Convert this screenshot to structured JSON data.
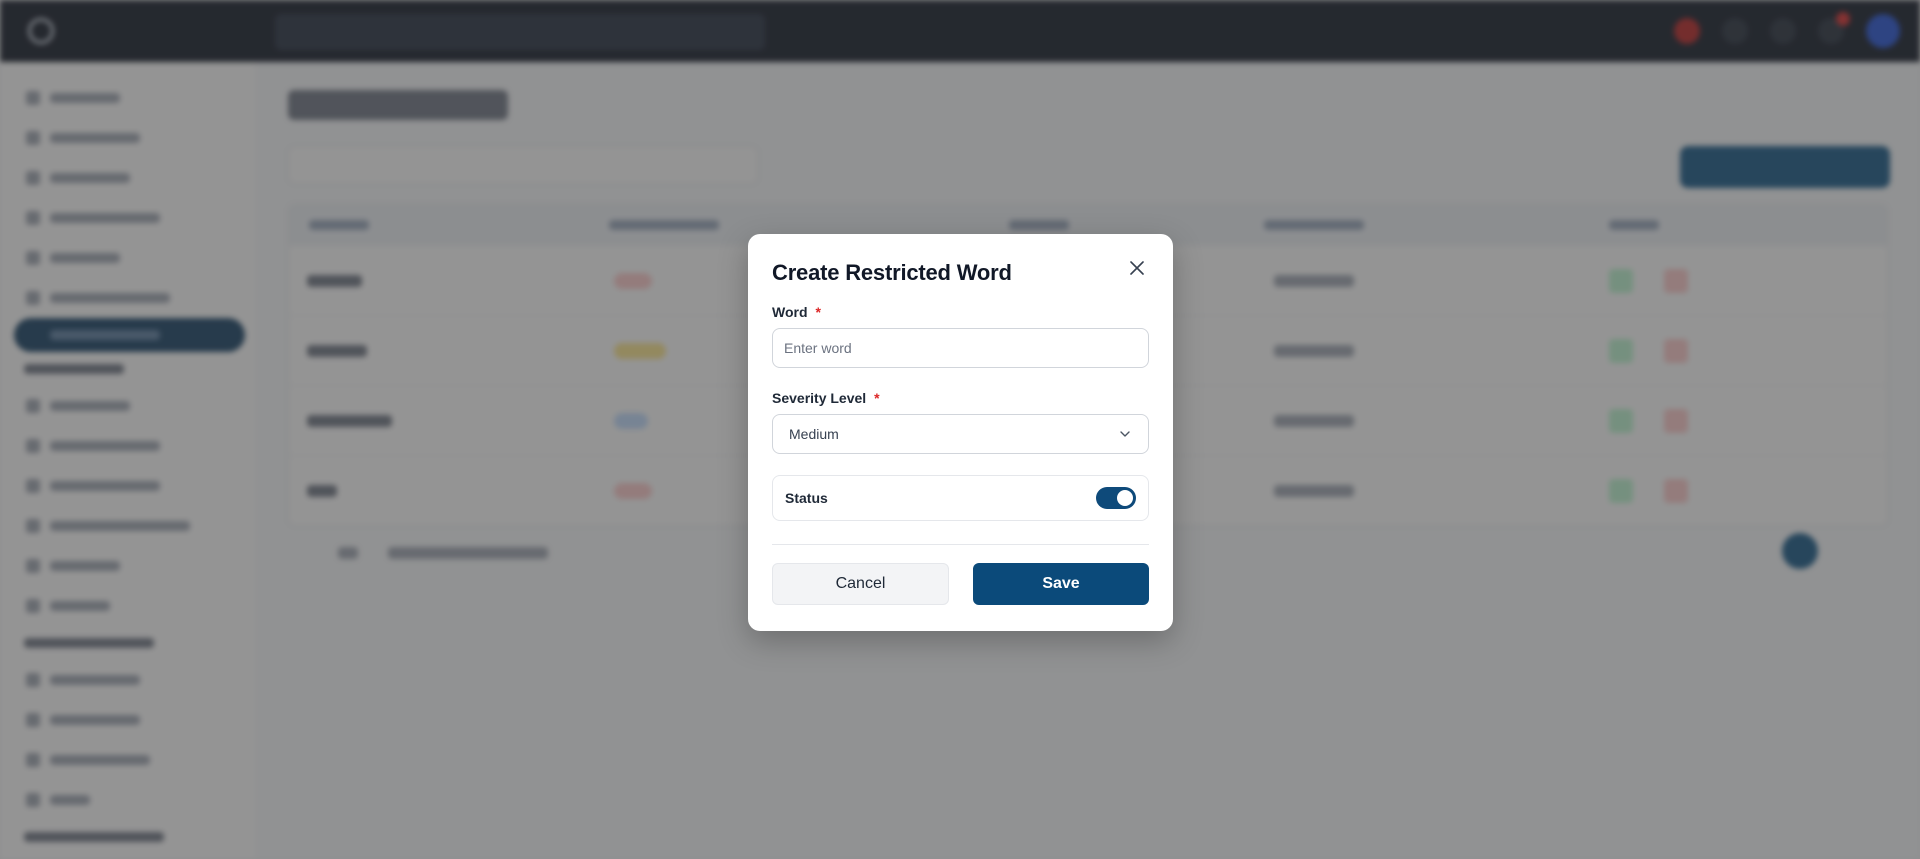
{
  "modal": {
    "title": "Create Restricted Word",
    "word_label": "Word",
    "word_required": "*",
    "word_placeholder": "Enter word",
    "word_value": "",
    "severity_label": "Severity Level",
    "severity_required": "*",
    "severity_value": "Medium",
    "status_label": "Status",
    "status_on": true,
    "cancel_label": "Cancel",
    "save_label": "Save"
  },
  "colors": {
    "primary": "#0b4a7a",
    "required": "#dc2626",
    "overlay": "rgba(60,60,60,0.55)"
  },
  "icons": {
    "close": "close-icon",
    "dropdown": "chevron-down-icon"
  }
}
